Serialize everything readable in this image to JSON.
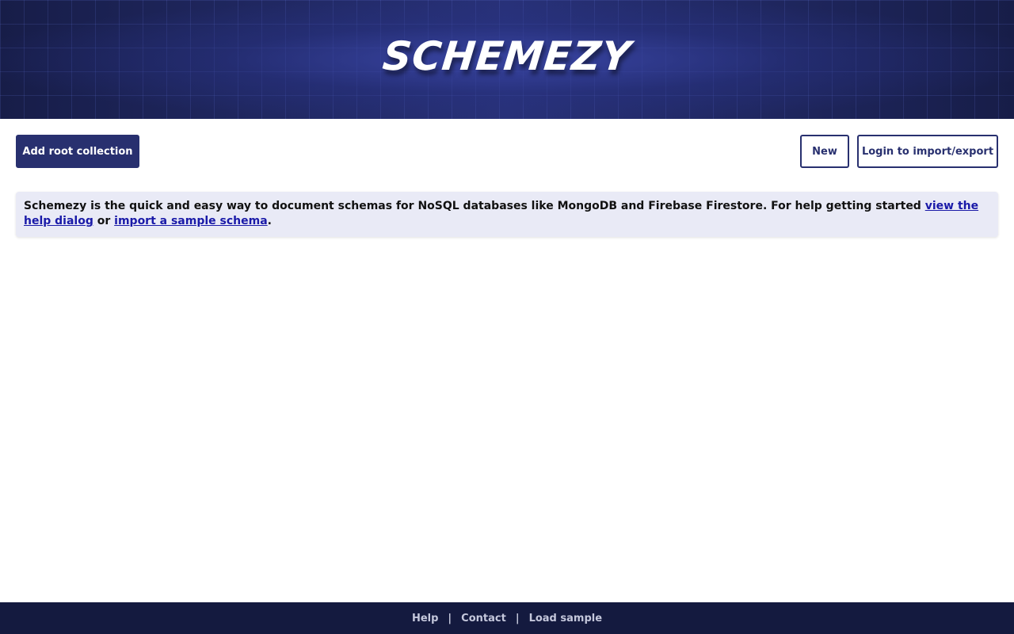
{
  "header": {
    "logo_text": "SCHEMEZY"
  },
  "toolbar": {
    "add_root_label": "Add root collection",
    "new_label": "New",
    "login_label": "Login to import/export"
  },
  "info": {
    "text_before": "Schemezy is the quick and easy way to document schemas for NoSQL databases like MongoDB and Firebase Firestore. For help getting started ",
    "help_link": "view the help dialog",
    "text_or": " or ",
    "sample_link": "import a sample schema",
    "text_end": "."
  },
  "footer": {
    "links": [
      "Help",
      "Contact",
      "Load sample"
    ],
    "separator": "|"
  },
  "colors": {
    "brand": "#28306f",
    "header_bg": "#232c66",
    "footer_bg": "#141a3f",
    "info_bg": "#e9eaf6",
    "link": "#1a1aa8"
  }
}
